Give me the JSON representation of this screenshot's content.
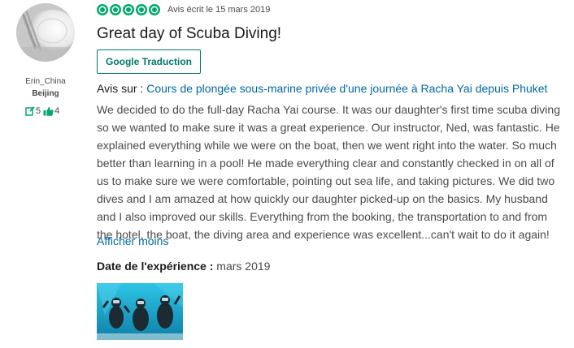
{
  "reviewer": {
    "name": "Erin_China",
    "location": "Beijing",
    "contributions": "5",
    "helpful_votes": "4"
  },
  "review": {
    "rating": 5,
    "date": "Avis écrit le 15 mars 2019",
    "title": "Great day of Scuba Diving!",
    "translate_button": "Google Traduction",
    "about_label": "Avis sur : ",
    "about_link": "Cours de plongée sous-marine privée d'une journée à Racha Yai depuis Phuket",
    "body_lines": [
      "We decided to do the full-day Racha Yai course. It was our daughter's first time scuba diving",
      "so we wanted to make sure it was a great experience. Our instructor, Ned, was fantastic. He",
      "explained everything while we were on the boat, then we went right into the water. So much",
      "better than learning in a pool! He made everything clear and constantly checked in on all of",
      "us to make sure we were comfortable, pointing out sea life, and taking pictures. We did two",
      "dives and I am amazed at how quickly our daughter picked-up on the basics. My husband",
      "and I also improved our skills. Everything from the booking, the transportation to and from",
      "the hotel, the boat, the diving area and experience was excellent...can't wait to do it again!"
    ],
    "show_less": "Afficher moins",
    "experience_label": "Date de l'expérience : ",
    "experience_date": "mars 2019"
  },
  "colors": {
    "bubble": "#00aa6c",
    "link": "#0068a0",
    "button": "#00796b"
  },
  "icons": {
    "contributions": "pencil-icon",
    "helpful": "thumbs-up-icon"
  }
}
